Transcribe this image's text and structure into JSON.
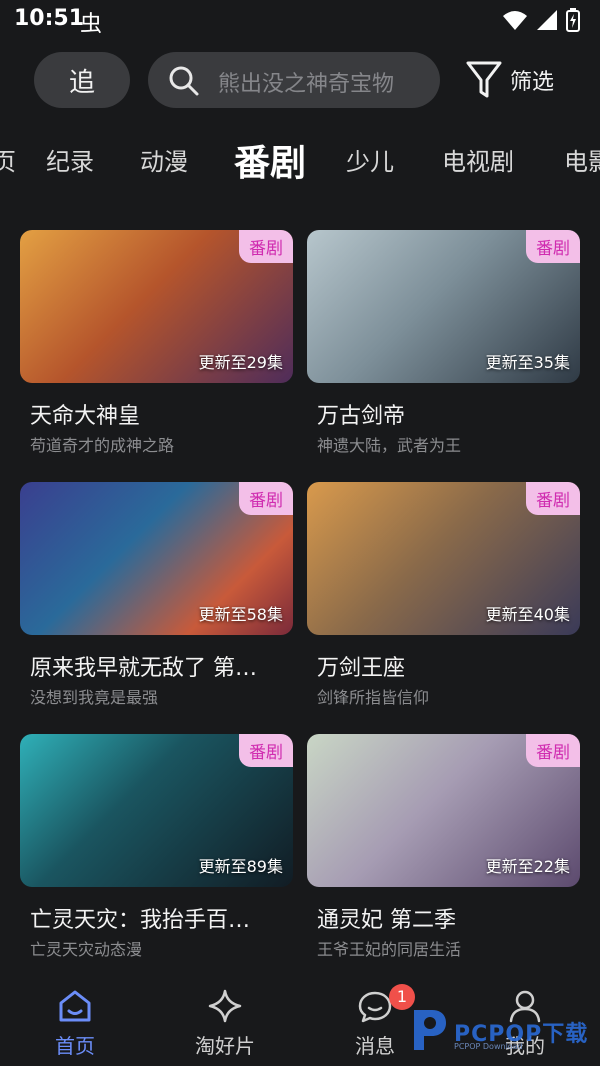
{
  "status_bar": {
    "time": "10:51",
    "notif_glyph": "虫"
  },
  "header": {
    "follow_label": "追",
    "search_placeholder": "熊出没之神奇宝物",
    "filter_label": "筛选"
  },
  "tabs": [
    {
      "label": "页"
    },
    {
      "label": "纪录"
    },
    {
      "label": "动漫"
    },
    {
      "label": "番剧"
    },
    {
      "label": "少儿"
    },
    {
      "label": "电视剧"
    },
    {
      "label": "电影"
    }
  ],
  "active_tab": "番剧",
  "cards": [
    {
      "title": "天命大神皇",
      "subtitle": "苟道奇才的成神之路",
      "badge": "番剧",
      "episodes": "更新至29集",
      "colors": [
        "#d8862e",
        "#6b3b6e"
      ]
    },
    {
      "title": "万古剑帝",
      "subtitle": "神遗大陆，武者为王",
      "badge": "番剧",
      "episodes": "更新至35集",
      "colors": [
        "#8aa3ad",
        "#3f4c57"
      ]
    },
    {
      "title": "原来我早就无敌了 第…",
      "subtitle": "没想到我竟是最强",
      "badge": "番剧",
      "episodes": "更新至58集",
      "colors": [
        "#2d3e88",
        "#c95b3a"
      ]
    },
    {
      "title": "万剑王座",
      "subtitle": "剑锋所指皆信仰",
      "badge": "番剧",
      "episodes": "更新至40集",
      "colors": [
        "#c8863f",
        "#3b3a55"
      ]
    },
    {
      "title": "亡灵天灾：我抬手百…",
      "subtitle": "亡灵天灾动态漫",
      "badge": "番剧",
      "episodes": "更新至89集",
      "colors": [
        "#1f8a9a",
        "#13252e"
      ]
    },
    {
      "title": "通灵妃 第二季",
      "subtitle": "王爷王妃的同居生活",
      "badge": "番剧",
      "episodes": "更新至22集",
      "colors": [
        "#b6c8b7",
        "#6d5a7e"
      ]
    }
  ],
  "bottom_nav": [
    {
      "label": "首页",
      "icon": "home-icon",
      "active": true
    },
    {
      "label": "淘好片",
      "icon": "sparkle-icon",
      "active": false
    },
    {
      "label": "消息",
      "icon": "chat-icon",
      "active": false,
      "badge": "1"
    },
    {
      "label": "我的",
      "icon": "user-icon",
      "active": false
    }
  ],
  "watermark": {
    "text": "PCPOP下载",
    "sub": "PCPOP Download"
  },
  "colors": {
    "accent": "#6b8df8",
    "badge_bg": "#f3bfe8",
    "badge_text": "#d02cb0",
    "bg": "#18191b"
  }
}
